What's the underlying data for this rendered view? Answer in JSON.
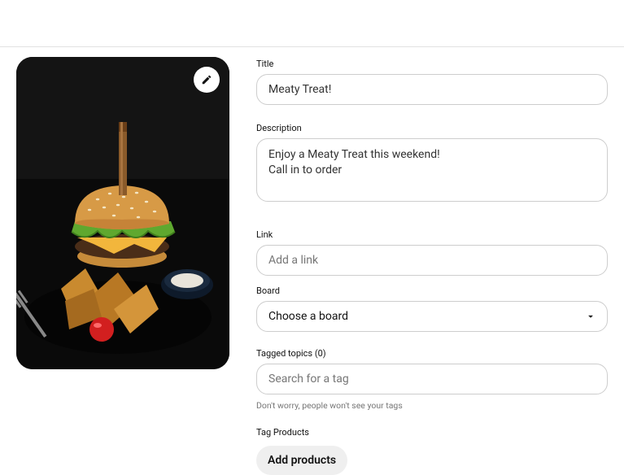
{
  "fields": {
    "title": {
      "label": "Title",
      "value": "Meaty Treat!"
    },
    "description": {
      "label": "Description",
      "value": "Enjoy a Meaty Treat this weekend!\nCall in to order"
    },
    "link": {
      "label": "Link",
      "placeholder": "Add a link"
    },
    "board": {
      "label": "Board",
      "selected": "Choose a board"
    },
    "tagged_topics": {
      "label": "Tagged topics (0)",
      "placeholder": "Search for a tag",
      "helper": "Don't worry, people won't see your tags"
    },
    "tag_products": {
      "label": "Tag Products",
      "button": "Add products"
    }
  },
  "icons": {
    "edit": "pencil-icon",
    "chevron": "chevron-down-icon"
  }
}
